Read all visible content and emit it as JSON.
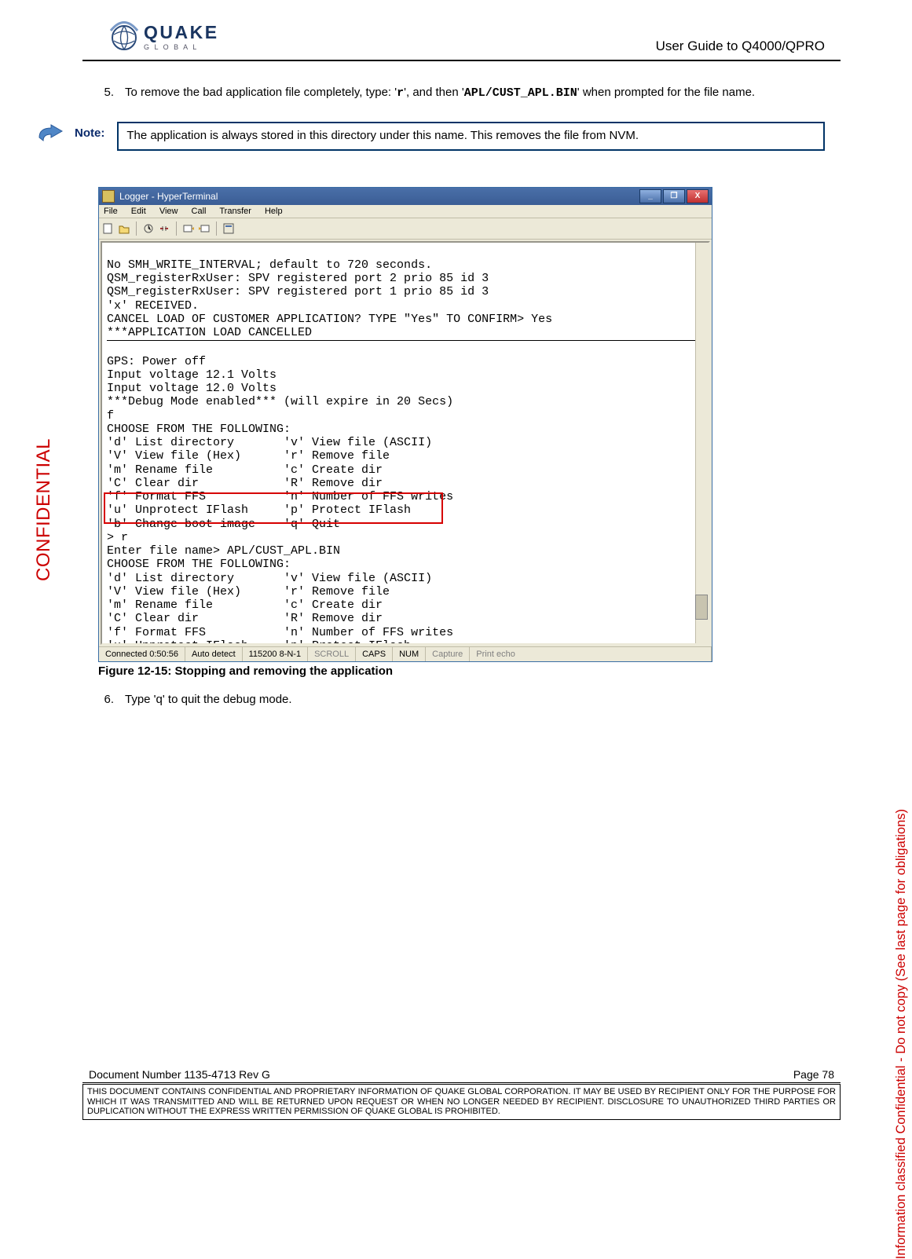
{
  "header": {
    "brand_top": "QUAKE",
    "brand_sub": "G  L  O  B  A  L",
    "title": "User Guide to Q4000/QPRO"
  },
  "body": {
    "step5_num": "5.",
    "step5_pre": "To remove the bad application file completely, type: '",
    "step5_code1": "r",
    "step5_mid": "', and then '",
    "step5_code2": "APL/CUST_APL.BIN",
    "step5_post": "' when prompted for the file name.",
    "note_label": "Note:",
    "note_text": "The application is always stored in this directory under this name.  This removes the file from NVM.",
    "fig_caption": "Figure 12-15:  Stopping and removing the application",
    "step6_num": "6.",
    "step6_text": "Type 'q' to quit the debug mode."
  },
  "terminal": {
    "title": "Logger - HyperTerminal",
    "menu": {
      "m1": "File",
      "m2": "Edit",
      "m3": "View",
      "m4": "Call",
      "m5": "Transfer",
      "m6": "Help"
    },
    "block1": "No SMH_WRITE_INTERVAL; default to 720 seconds.\nQSM_registerRxUser: SPV registered port 2 prio 85 id 3\nQSM_registerRxUser: SPV registered port 1 prio 85 id 3\n'x' RECEIVED.\nCANCEL LOAD OF CUSTOMER APPLICATION? TYPE \"Yes\" TO CONFIRM> Yes\n***APPLICATION LOAD CANCELLED",
    "block2": "GPS: Power off\nInput voltage 12.1 Volts\nInput voltage 12.0 Volts\n***Debug Mode enabled*** (will expire in 20 Secs)\nf\nCHOOSE FROM THE FOLLOWING:\n'd' List directory       'v' View file (ASCII)\n'V' View file (Hex)      'r' Remove file\n'm' Rename file          'c' Create dir\n'C' Clear dir            'R' Remove dir\n'f' Format FFS           'n' Number of FFS writes\n'u' Unprotect IFlash     'p' Protect IFlash\n'b' Change boot image    'q' Quit",
    "block3": "> r\nEnter file name> APL/CUST_APL.BIN",
    "block4": "CHOOSE FROM THE FOLLOWING:\n'd' List directory       'v' View file (ASCII)\n'V' View file (Hex)      'r' Remove file\n'm' Rename file          'c' Create dir\n'C' Clear dir            'R' Remove dir\n'f' Format FFS           'n' Number of FFS writes\n'u' Unprotect IFlash     'p' Protect IFlash\n'b' Change boot image    'q' Quit\n>",
    "status": {
      "s1": "Connected 0:50:56",
      "s2": "Auto detect",
      "s3": "115200 8-N-1",
      "s4": "SCROLL",
      "s5": "CAPS",
      "s6": "NUM",
      "s7": "Capture",
      "s8": "Print echo"
    }
  },
  "footer": {
    "doc": "Document Number 1135-4713   Rev G",
    "page": "Page 78",
    "legal": "THIS DOCUMENT CONTAINS CONFIDENTIAL AND PROPRIETARY INFORMATION OF QUAKE GLOBAL CORPORATION.  IT MAY BE USED BY RECIPIENT ONLY FOR THE PURPOSE FOR WHICH IT WAS TRANSMITTED AND WILL BE RETURNED UPON REQUEST OR WHEN NO LONGER NEEDED BY RECIPIENT.  DISCLOSURE TO UNAUTHORIZED THIRD PARTIES OR DUPLICATION WITHOUT THE EXPRESS WRITTEN PERMISSION OF QUAKE GLOBAL IS PROHIBITED."
  },
  "sides": {
    "left": "CONFIDENTIAL",
    "right": "Information classified Confidential - Do not copy (See last page for obligations)"
  }
}
